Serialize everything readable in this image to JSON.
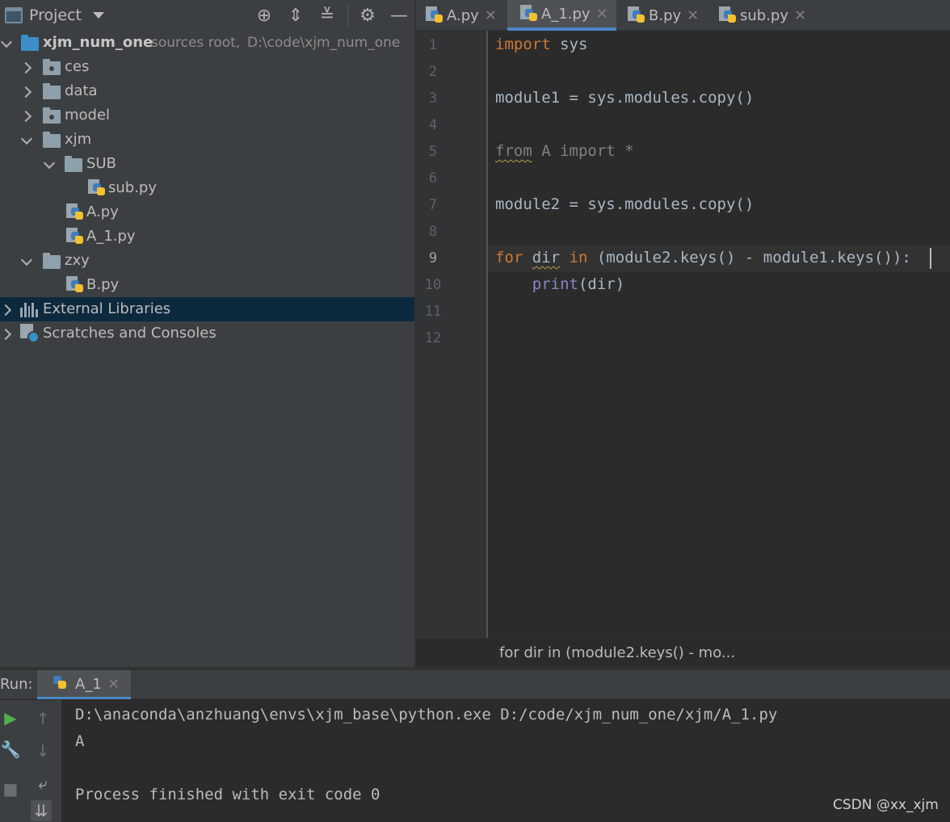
{
  "project_panel": {
    "title": "Project",
    "root": {
      "name": "xjm_num_one",
      "note": "sources root,",
      "path": "D:\\code\\xjm_num_one"
    },
    "tree": [
      "ces",
      "data",
      "model",
      "xjm",
      "SUB",
      "sub.py",
      "A.py",
      "A_1.py",
      "zxy",
      "B.py"
    ],
    "external_libraries": "External Libraries",
    "scratches": "Scratches and Consoles"
  },
  "editor": {
    "tabs": [
      "A.py",
      "A_1.py",
      "B.py",
      "sub.py"
    ],
    "active_tab": "A_1.py",
    "line_numbers": [
      "1",
      "2",
      "3",
      "4",
      "5",
      "6",
      "7",
      "8",
      "9",
      "10",
      "11",
      "12"
    ],
    "current_line": "9",
    "code": {
      "l1_kw": "import",
      "l1_rest": " sys",
      "l3": "module1 = sys.modules.copy()",
      "l5_from": "from",
      "l5_rest": " A import *",
      "l7": "module2 = sys.modules.copy()",
      "l9_for": "for",
      "l9_dir": "dir",
      "l9_in": "in",
      "l9_rest": " (module2.keys() - module1.keys()):",
      "l10_print": "print",
      "l10_rest": "(dir)"
    },
    "breadcrumb": "for dir in (module2.keys() - mo..."
  },
  "run_panel": {
    "label": "Run:",
    "tab": "A_1",
    "output": [
      "D:\\anaconda\\anzhuang\\envs\\xjm_base\\python.exe D:/code/xjm_num_one/xjm/A_1.py",
      "A",
      "",
      "Process finished with exit code 0"
    ]
  },
  "watermark": "CSDN @xx_xjm"
}
